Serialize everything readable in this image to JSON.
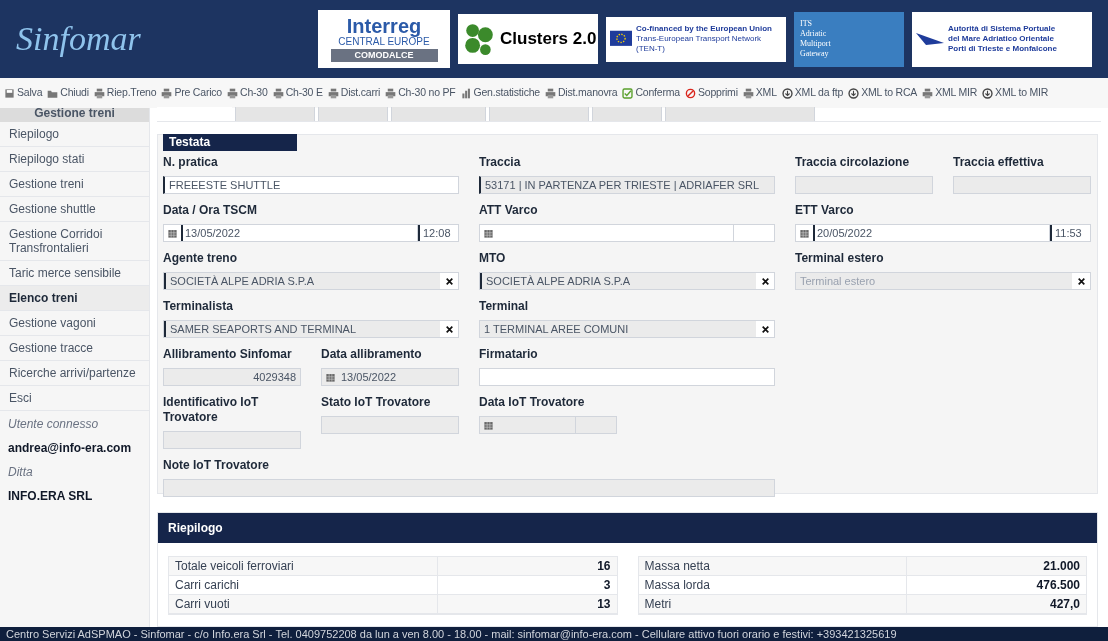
{
  "header": {
    "logo": "Sinfomar",
    "partners": [
      {
        "kind": "interreg",
        "lines": [
          "Interreg",
          "CENTRAL EUROPE",
          "COMODALCE"
        ]
      },
      {
        "kind": "clusters",
        "lines": [
          "Clusters 2.0"
        ]
      },
      {
        "kind": "eu",
        "lines": [
          "Co-financed by the European Union",
          "Trans-European Transport Network (TEN-T)"
        ]
      },
      {
        "kind": "its",
        "lines": [
          "ITS",
          "Adriatic",
          "Multiport",
          "Gateway"
        ]
      },
      {
        "kind": "port",
        "lines": [
          "Autorità di Sistema Portuale",
          "del Mare Adriatico Orientale",
          "Porti di Trieste e Monfalcone"
        ]
      }
    ]
  },
  "toolbar": [
    {
      "kind": "save",
      "label": "Salva"
    },
    {
      "kind": "folder",
      "label": "Chiudi"
    },
    {
      "kind": "print",
      "label": "Riep.Treno"
    },
    {
      "kind": "print",
      "label": "Pre Carico"
    },
    {
      "kind": "print",
      "label": "Ch-30"
    },
    {
      "kind": "print",
      "label": "Ch-30 E"
    },
    {
      "kind": "print",
      "label": "Dist.carri"
    },
    {
      "kind": "print",
      "label": "Ch-30 no PF"
    },
    {
      "kind": "chart",
      "label": "Gen.statistiche"
    },
    {
      "kind": "print",
      "label": "Dist.manovra"
    },
    {
      "kind": "check",
      "label": "Conferma"
    },
    {
      "kind": "ban",
      "label": "Sopprimi"
    },
    {
      "kind": "print",
      "label": "XML"
    },
    {
      "kind": "download",
      "label": "XML da ftp"
    },
    {
      "kind": "download",
      "label": "XML to RCA"
    },
    {
      "kind": "print",
      "label": "XML MIR"
    },
    {
      "kind": "download",
      "label": "XML to MIR"
    }
  ],
  "sidebar": {
    "title": "Gestione treni",
    "items": [
      {
        "label": "Riepilogo",
        "selected": false
      },
      {
        "label": "Riepilogo stati",
        "selected": false
      },
      {
        "label": "Gestione treni",
        "selected": false
      },
      {
        "label": "Gestione shuttle",
        "selected": false
      },
      {
        "label": "Gestione Corridoi Transfrontalieri",
        "selected": false
      },
      {
        "label": "Taric merce sensibile",
        "selected": false
      },
      {
        "label": "Elenco treni",
        "selected": true
      },
      {
        "label": "Gestione vagoni",
        "selected": false
      },
      {
        "label": "Gestione tracce",
        "selected": false
      },
      {
        "label": "Ricerche arrivi/partenze",
        "selected": false
      },
      {
        "label": "Esci",
        "selected": false
      }
    ],
    "user_label": "Utente connesso",
    "user": "andrea@info-era.com",
    "company_label": "Ditta",
    "company": "INFO.ERA SRL"
  },
  "tabs": [
    {
      "selected": true
    },
    {
      "selected": false
    },
    {
      "selected": false
    },
    {
      "selected": false
    },
    {
      "selected": false
    },
    {
      "selected": false
    },
    {
      "selected": false
    }
  ],
  "testata": {
    "title": "Testata",
    "fields": [
      {
        "kind": "text",
        "label": "N. pratica",
        "value": "FREEESTE SHUTTLE",
        "readonly": false,
        "required": true
      },
      {
        "kind": "text",
        "label": "Traccia",
        "value": "53171 | IN PARTENZA PER TRIESTE | ADRIAFER SRL",
        "readonly": true,
        "required": true
      },
      {
        "kind": "text",
        "label": "Traccia circolazione",
        "readonly": true,
        "required": false
      },
      {
        "kind": "text",
        "label": "Traccia effettiva",
        "readonly": true,
        "required": false
      },
      {
        "kind": "datetime",
        "label": "Data / Ora TSCM",
        "date": "13/05/2022",
        "time": "12:08",
        "readonly": false,
        "required": true
      },
      {
        "kind": "datetime",
        "label": "ATT Varco",
        "readonly": false,
        "required": false
      },
      {
        "kind": "datetime",
        "label": "ETT Varco",
        "date": "20/05/2022",
        "time": "11:53",
        "readonly": false,
        "required": true
      },
      {
        "kind": "select",
        "label": "Agente treno",
        "value": "SOCIETÀ ALPE ADRIA S.P.A",
        "readonly": true,
        "required": true
      },
      {
        "kind": "select",
        "label": "MTO",
        "value": "SOCIETÀ ALPE ADRIA S.P.A",
        "readonly": true,
        "required": true
      },
      {
        "kind": "select",
        "label": "Terminal estero",
        "placeholder": "Terminal estero",
        "readonly": true,
        "required": false
      },
      {
        "kind": "select",
        "label": "Terminalista",
        "value": "SAMER SEAPORTS AND TERMINAL",
        "readonly": true,
        "required": true
      },
      {
        "kind": "select",
        "label": "Terminal",
        "value": "1 TERMINAL AREE COMUNI",
        "readonly": true,
        "required": false
      },
      {
        "kind": "number",
        "label": "Allibramento Sinfomar",
        "value": "4029348",
        "readonly": true,
        "required": false
      },
      {
        "kind": "date",
        "label": "Data allibramento",
        "date": "13/05/2022",
        "readonly": true,
        "required": false
      },
      {
        "kind": "text",
        "label": "Firmatario",
        "readonly": false,
        "required": false
      },
      {
        "kind": "text",
        "label": "Identificativo IoT Trovatore",
        "readonly": true,
        "required": false
      },
      {
        "kind": "text",
        "label": "Stato IoT Trovatore",
        "readonly": true,
        "required": false
      },
      {
        "kind": "datetime",
        "label": "Data IoT Trovatore",
        "readonly": true,
        "required": false
      },
      {
        "kind": "text",
        "label": "Note IoT Trovatore",
        "readonly": true,
        "required": false
      }
    ]
  },
  "riepilogo": {
    "title": "Riepilogo",
    "tables": [
      [
        {
          "label": "Totale veicoli ferroviari",
          "value": "16"
        },
        {
          "label": "Carri carichi",
          "value": "3"
        },
        {
          "label": "Carri vuoti",
          "value": "13"
        }
      ],
      [
        {
          "label": "Massa netta",
          "value": "21.000"
        },
        {
          "label": "Massa lorda",
          "value": "476.500"
        },
        {
          "label": "Metri",
          "value": "427,0"
        }
      ]
    ]
  },
  "footer": "Centro Servizi AdSPMAO - Sinfomar - c/o Info.era Srl - Tel. 0409752208 da lun a ven 8.00 - 18.00 - mail: sinfomar@info-era.com - Cellulare attivo fuori orario e festivi: +393421325619"
}
